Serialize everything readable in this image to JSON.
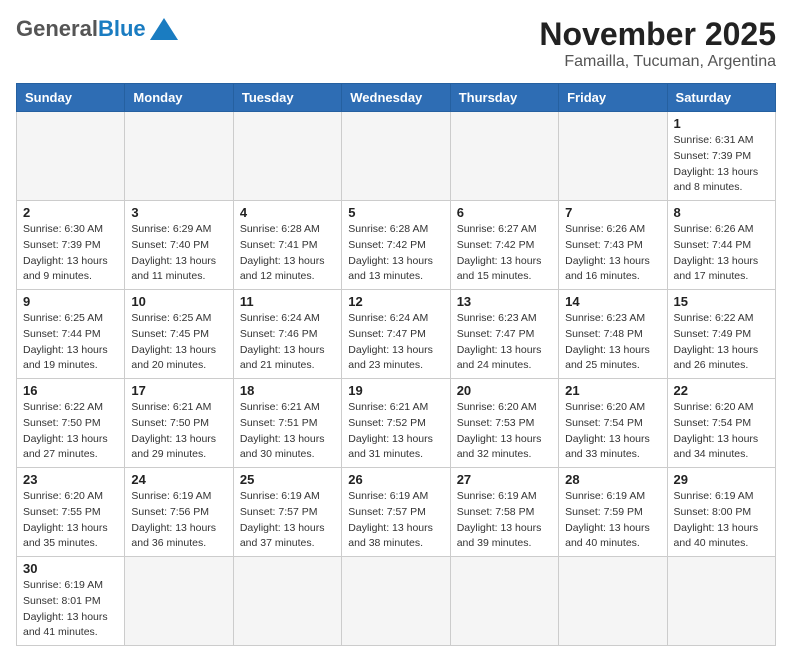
{
  "header": {
    "logo_general": "General",
    "logo_blue": "Blue",
    "month": "November 2025",
    "location": "Famailla, Tucuman, Argentina"
  },
  "weekdays": [
    "Sunday",
    "Monday",
    "Tuesday",
    "Wednesday",
    "Thursday",
    "Friday",
    "Saturday"
  ],
  "days": {
    "1": {
      "sunrise": "6:31 AM",
      "sunset": "7:39 PM",
      "daylight": "13 hours and 8 minutes."
    },
    "2": {
      "sunrise": "6:30 AM",
      "sunset": "7:39 PM",
      "daylight": "13 hours and 9 minutes."
    },
    "3": {
      "sunrise": "6:29 AM",
      "sunset": "7:40 PM",
      "daylight": "13 hours and 11 minutes."
    },
    "4": {
      "sunrise": "6:28 AM",
      "sunset": "7:41 PM",
      "daylight": "13 hours and 12 minutes."
    },
    "5": {
      "sunrise": "6:28 AM",
      "sunset": "7:42 PM",
      "daylight": "13 hours and 13 minutes."
    },
    "6": {
      "sunrise": "6:27 AM",
      "sunset": "7:42 PM",
      "daylight": "13 hours and 15 minutes."
    },
    "7": {
      "sunrise": "6:26 AM",
      "sunset": "7:43 PM",
      "daylight": "13 hours and 16 minutes."
    },
    "8": {
      "sunrise": "6:26 AM",
      "sunset": "7:44 PM",
      "daylight": "13 hours and 17 minutes."
    },
    "9": {
      "sunrise": "6:25 AM",
      "sunset": "7:44 PM",
      "daylight": "13 hours and 19 minutes."
    },
    "10": {
      "sunrise": "6:25 AM",
      "sunset": "7:45 PM",
      "daylight": "13 hours and 20 minutes."
    },
    "11": {
      "sunrise": "6:24 AM",
      "sunset": "7:46 PM",
      "daylight": "13 hours and 21 minutes."
    },
    "12": {
      "sunrise": "6:24 AM",
      "sunset": "7:47 PM",
      "daylight": "13 hours and 23 minutes."
    },
    "13": {
      "sunrise": "6:23 AM",
      "sunset": "7:47 PM",
      "daylight": "13 hours and 24 minutes."
    },
    "14": {
      "sunrise": "6:23 AM",
      "sunset": "7:48 PM",
      "daylight": "13 hours and 25 minutes."
    },
    "15": {
      "sunrise": "6:22 AM",
      "sunset": "7:49 PM",
      "daylight": "13 hours and 26 minutes."
    },
    "16": {
      "sunrise": "6:22 AM",
      "sunset": "7:50 PM",
      "daylight": "13 hours and 27 minutes."
    },
    "17": {
      "sunrise": "6:21 AM",
      "sunset": "7:50 PM",
      "daylight": "13 hours and 29 minutes."
    },
    "18": {
      "sunrise": "6:21 AM",
      "sunset": "7:51 PM",
      "daylight": "13 hours and 30 minutes."
    },
    "19": {
      "sunrise": "6:21 AM",
      "sunset": "7:52 PM",
      "daylight": "13 hours and 31 minutes."
    },
    "20": {
      "sunrise": "6:20 AM",
      "sunset": "7:53 PM",
      "daylight": "13 hours and 32 minutes."
    },
    "21": {
      "sunrise": "6:20 AM",
      "sunset": "7:54 PM",
      "daylight": "13 hours and 33 minutes."
    },
    "22": {
      "sunrise": "6:20 AM",
      "sunset": "7:54 PM",
      "daylight": "13 hours and 34 minutes."
    },
    "23": {
      "sunrise": "6:20 AM",
      "sunset": "7:55 PM",
      "daylight": "13 hours and 35 minutes."
    },
    "24": {
      "sunrise": "6:19 AM",
      "sunset": "7:56 PM",
      "daylight": "13 hours and 36 minutes."
    },
    "25": {
      "sunrise": "6:19 AM",
      "sunset": "7:57 PM",
      "daylight": "13 hours and 37 minutes."
    },
    "26": {
      "sunrise": "6:19 AM",
      "sunset": "7:57 PM",
      "daylight": "13 hours and 38 minutes."
    },
    "27": {
      "sunrise": "6:19 AM",
      "sunset": "7:58 PM",
      "daylight": "13 hours and 39 minutes."
    },
    "28": {
      "sunrise": "6:19 AM",
      "sunset": "7:59 PM",
      "daylight": "13 hours and 40 minutes."
    },
    "29": {
      "sunrise": "6:19 AM",
      "sunset": "8:00 PM",
      "daylight": "13 hours and 40 minutes."
    },
    "30": {
      "sunrise": "6:19 AM",
      "sunset": "8:01 PM",
      "daylight": "13 hours and 41 minutes."
    }
  },
  "labels": {
    "sunrise": "Sunrise:",
    "sunset": "Sunset:",
    "daylight": "Daylight:"
  }
}
